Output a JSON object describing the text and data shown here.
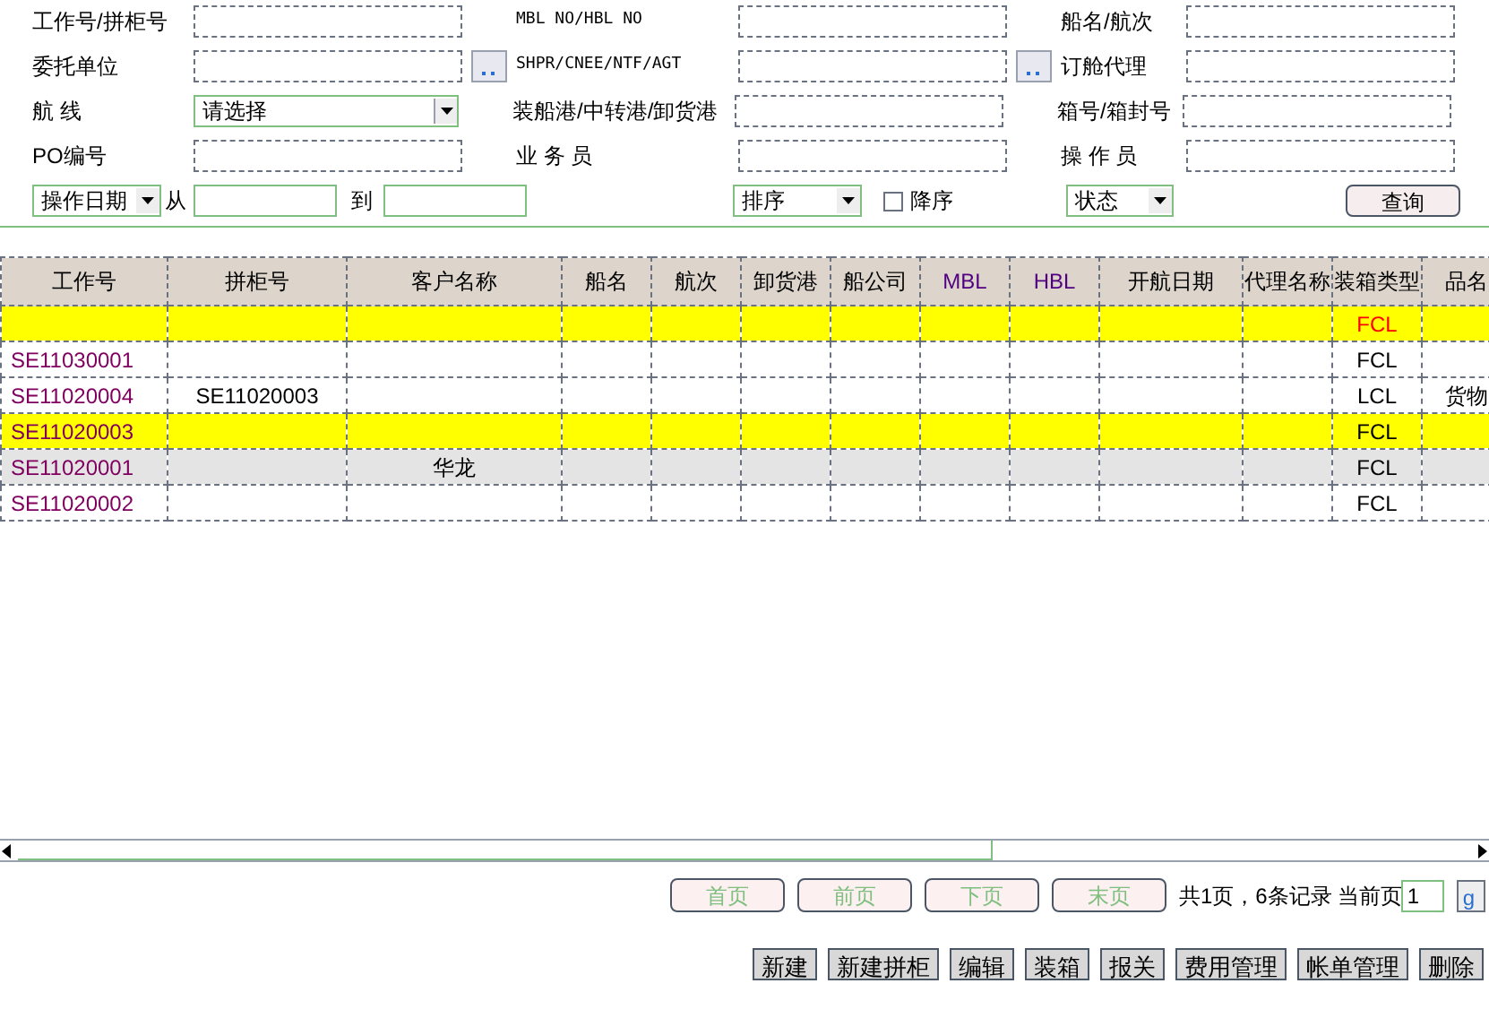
{
  "filters": [
    {
      "kind": "text",
      "label": "工作号/拼柜号",
      "lookup": false
    },
    {
      "kind": "text",
      "label": "MBL NO/HBL NO",
      "lookup": false,
      "mono": true
    },
    {
      "kind": "text",
      "label": "船名/航次",
      "lookup": false
    },
    {
      "kind": "text",
      "label": "委托单位",
      "lookup": true
    },
    {
      "kind": "text",
      "label": "SHPR/CNEE/NTF/AGT",
      "lookup": true,
      "mono": true
    },
    {
      "kind": "text",
      "label": "订舱代理",
      "lookup": false
    },
    {
      "kind": "select",
      "label": "航 线",
      "value": "请选择"
    },
    {
      "kind": "text",
      "label": "装船港/中转港/卸货港",
      "lookup": false
    },
    {
      "kind": "text",
      "label": "箱号/箱封号",
      "lookup": false
    },
    {
      "kind": "text",
      "label": "PO编号",
      "lookup": false
    },
    {
      "kind": "text",
      "label": "业 务 员",
      "lookup": false
    },
    {
      "kind": "text",
      "label": "操 作 员",
      "lookup": false
    }
  ],
  "date_filter": {
    "field": "操作日期",
    "from": "从",
    "to": "到"
  },
  "sort": {
    "value": "排序",
    "descending_label": "降序",
    "descending": false
  },
  "status": {
    "value": "状态"
  },
  "query_button": "查询",
  "table": {
    "columns": [
      "工作号",
      "拼柜号",
      "客户名称",
      "船名",
      "航次",
      "卸货港",
      "船公司",
      "MBL",
      "HBL",
      "开航日期",
      "代理名称",
      "装箱类型",
      "品名"
    ],
    "rows": [
      {
        "cells": [
          "",
          "",
          "",
          "",
          "",
          "",
          "",
          "",
          "",
          "",
          "",
          "FCL",
          ""
        ],
        "selected": true,
        "hovered": false,
        "warning": true
      },
      {
        "cells": [
          "SE11030001",
          "",
          "",
          "",
          "",
          "",
          "",
          "",
          "",
          "",
          "",
          "FCL",
          ""
        ],
        "selected": false,
        "hovered": false,
        "warning": false
      },
      {
        "cells": [
          "SE11020004",
          "SE11020003",
          "",
          "",
          "",
          "",
          "",
          "",
          "",
          "",
          "",
          "LCL",
          "货物"
        ],
        "selected": false,
        "hovered": false,
        "warning": false
      },
      {
        "cells": [
          "SE11020003",
          "",
          "",
          "",
          "",
          "",
          "",
          "",
          "",
          "",
          "",
          "FCL",
          ""
        ],
        "selected": true,
        "hovered": false,
        "warning": false
      },
      {
        "cells": [
          "SE11020001",
          "",
          "华龙",
          "",
          "",
          "",
          "",
          "",
          "",
          "",
          "",
          "FCL",
          ""
        ],
        "selected": false,
        "hovered": true,
        "warning": false
      },
      {
        "cells": [
          "SE11020002",
          "",
          "",
          "",
          "",
          "",
          "",
          "",
          "",
          "",
          "",
          "FCL",
          ""
        ],
        "selected": false,
        "hovered": false,
        "warning": false
      }
    ]
  },
  "pager": {
    "buttons": [
      "首页",
      "前页",
      "下页",
      "末页"
    ],
    "summary": "共1页，6条记录",
    "current_label": "当前页",
    "current": "1",
    "go": "g"
  },
  "actions": [
    "新建",
    "新建拼柜",
    "编辑",
    "装箱",
    "报关",
    "费用管理",
    "帐单管理",
    "删除"
  ]
}
